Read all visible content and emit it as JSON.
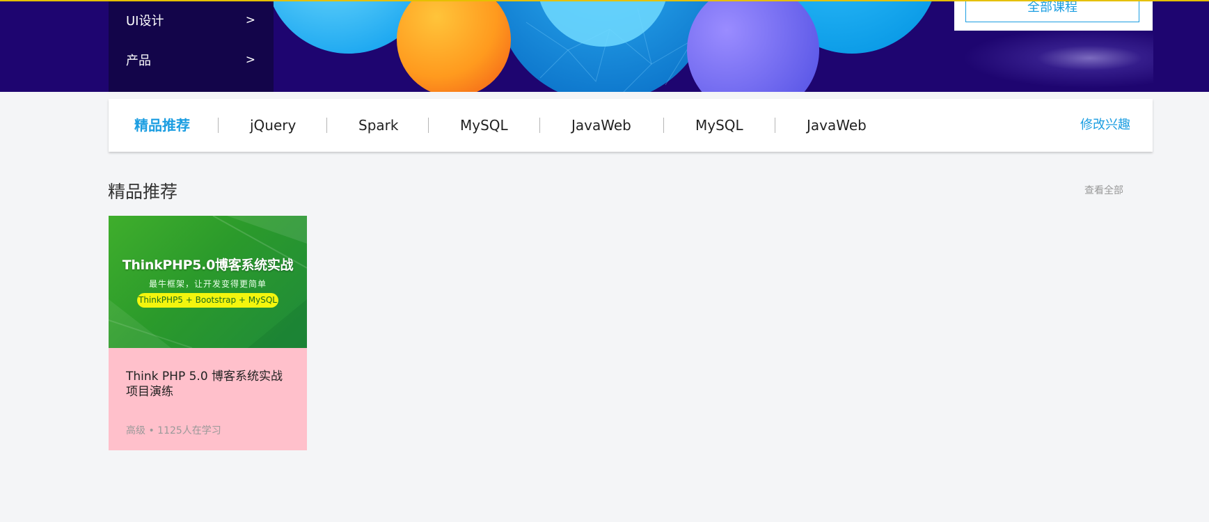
{
  "banner": {
    "categories": [
      {
        "label": "UI设计",
        "arrow": ">"
      },
      {
        "label": "产品",
        "arrow": ">"
      }
    ],
    "all_courses_label": "全部课程"
  },
  "interest_nav": {
    "items": [
      {
        "label": "精品推荐",
        "active": true
      },
      {
        "label": "jQuery",
        "active": false
      },
      {
        "label": "Spark",
        "active": false
      },
      {
        "label": "MySQL",
        "active": false
      },
      {
        "label": "JavaWeb",
        "active": false
      },
      {
        "label": "MySQL",
        "active": false
      },
      {
        "label": "JavaWeb",
        "active": false
      }
    ],
    "edit_label": "修改兴趣"
  },
  "section": {
    "title": "精品推荐",
    "view_all_label": "查看全部"
  },
  "courses": [
    {
      "cover_title": "ThinkPHP5.0博客系统实战",
      "cover_subtitle": "最牛框架，让开发变得更简单",
      "cover_tags": "ThinkPHP5 + Bootstrap + MySQL",
      "name": "Think PHP 5.0 博客系统实战项目演练",
      "meta": "高级 • 1125人在学习"
    }
  ],
  "colors": {
    "accent": "#1a9de1",
    "banner_bg": "#1e0570",
    "card_bg": "#ffc0cb",
    "page_bg": "#f4f5f7"
  }
}
